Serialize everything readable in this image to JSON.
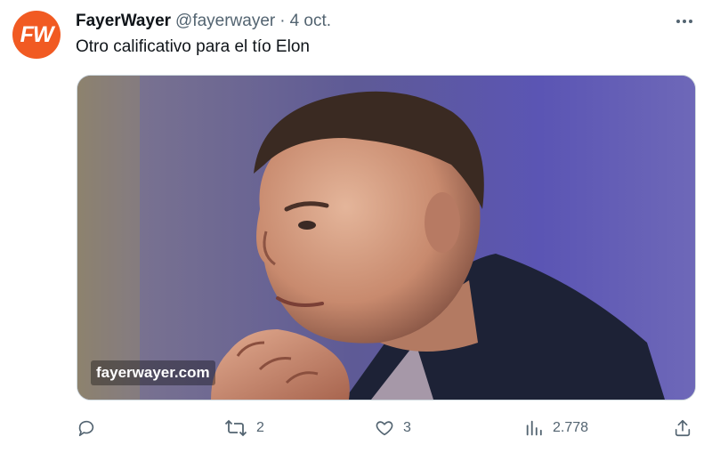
{
  "tweet": {
    "avatar_text": "FW",
    "author_name": "FayerWayer",
    "author_handle": "@fayerwayer",
    "separator": "·",
    "date": "4 oct.",
    "text": "Otro calificativo para el tío Elon",
    "media": {
      "watermark": "fayerwayer.com"
    },
    "actions": {
      "reply_count": "",
      "retweet_count": "2",
      "like_count": "3",
      "views_count": "2.778"
    }
  },
  "colors": {
    "brand": "#f15a22",
    "text": "#0f1419",
    "secondary": "#536471"
  },
  "icons": [
    "more-icon",
    "reply-icon",
    "retweet-icon",
    "like-icon",
    "views-icon",
    "share-icon"
  ]
}
